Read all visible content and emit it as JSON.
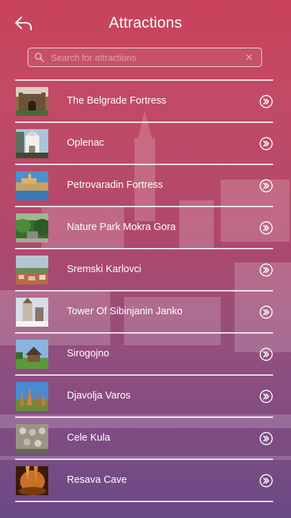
{
  "header": {
    "title": "Attractions",
    "back_icon": "back-arrow-icon"
  },
  "search": {
    "placeholder": "Search for attractions",
    "value": "",
    "icon": "search-icon",
    "clear_icon": "close-icon"
  },
  "colors": {
    "background_top": "#c8435a",
    "background_bottom": "#6a4a86",
    "text": "#ffffff"
  },
  "attractions": [
    {
      "name": "The Belgrade Fortress",
      "thumb": "fortress-photo"
    },
    {
      "name": "Oplenac",
      "thumb": "church-photo"
    },
    {
      "name": "Petrovaradin Fortress",
      "thumb": "river-fortress-photo"
    },
    {
      "name": "Nature Park Mokra Gora",
      "thumb": "forest-photo"
    },
    {
      "name": "Sremski Karlovci",
      "thumb": "town-photo"
    },
    {
      "name": "Tower Of Sibinjanin Janko",
      "thumb": "winter-tower-photo"
    },
    {
      "name": "Sirogojno",
      "thumb": "village-house-photo"
    },
    {
      "name": "Djavolja Varos",
      "thumb": "rock-formations-photo"
    },
    {
      "name": "Cele Kula",
      "thumb": "skull-tower-photo"
    },
    {
      "name": "Resava Cave",
      "thumb": "cave-photo"
    }
  ],
  "row_action_icon": "double-chevron-right-icon"
}
